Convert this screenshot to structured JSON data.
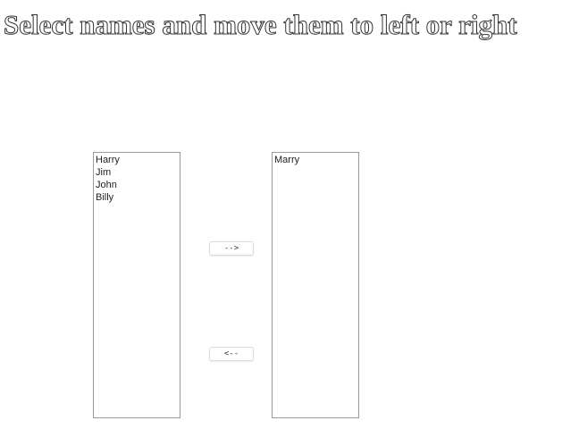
{
  "heading": "Select names and move them to left or right",
  "left_list": {
    "options": [
      "Harry",
      "Jim",
      "John",
      "Billy"
    ]
  },
  "right_list": {
    "options": [
      "Marry"
    ]
  },
  "buttons": {
    "move_right_label": "-->",
    "move_left_label": "<--"
  }
}
